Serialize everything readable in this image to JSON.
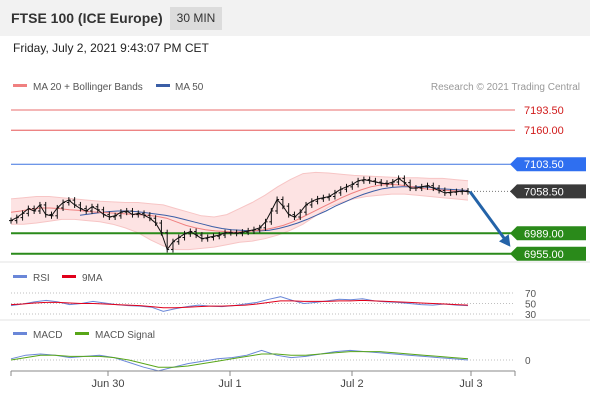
{
  "header": {
    "title": "FTSE 100 (ICE Europe)",
    "timeframe": "30 MIN"
  },
  "datetime": "Friday, July 2, 2021 9:43:07 PM CET",
  "chart_data": [
    {
      "type": "line",
      "panel": "price",
      "legend": [
        {
          "label": "MA 20 + Bollinger Bands",
          "color": "#f08080"
        },
        {
          "label": "MA 50",
          "color": "#3b5ea6"
        }
      ],
      "credit": "Research © 2021 Trading Central",
      "levels": [
        {
          "value": 7193.5,
          "label": "7193.50",
          "kind": "resistance"
        },
        {
          "value": 7160.0,
          "label": "7160.00",
          "kind": "resistance"
        },
        {
          "value": 7103.5,
          "label": "7103.50",
          "kind": "pivot"
        },
        {
          "value": 7058.5,
          "label": "7058.50",
          "kind": "last"
        },
        {
          "value": 6989.0,
          "label": "6989.00",
          "kind": "support"
        },
        {
          "value": 6955.0,
          "label": "6955.00",
          "kind": "support"
        }
      ],
      "x_ticks": [
        "Jun 30",
        "Jul 1",
        "Jul 2",
        "Jul 3"
      ],
      "ylim": [
        6948,
        7215
      ],
      "price": [
        7010,
        7015,
        7022,
        7030,
        7026,
        7036,
        7020,
        7018,
        7031,
        7040,
        7044,
        7036,
        7030,
        7026,
        7033,
        7028,
        7020,
        7016,
        7018,
        7024,
        7026,
        7020,
        7022,
        7019,
        7014,
        7006,
        6990,
        6962,
        6975,
        6982,
        6988,
        6992,
        6986,
        6980,
        6982,
        6984,
        6986,
        6990,
        6990,
        6989,
        6991,
        6993,
        6995,
        6998,
        7008,
        7026,
        7045,
        7034,
        7020,
        7016,
        7024,
        7036,
        7042,
        7046,
        7048,
        7050,
        7056,
        7062,
        7066,
        7070,
        7076,
        7078,
        7076,
        7074,
        7072,
        7071,
        7074,
        7080,
        7073,
        7064,
        7064,
        7066,
        7068,
        7064,
        7060,
        7056,
        7057,
        7058,
        7059,
        7058
      ],
      "ma20": [
        7024,
        7026,
        7029,
        7031,
        7031,
        7030,
        7028,
        7027,
        7025,
        7024,
        7023,
        7022,
        7021,
        7020,
        7019,
        7017,
        7014,
        7008,
        7002,
        6998,
        6995,
        6993,
        6992,
        6991,
        6992,
        6993,
        6995,
        6998,
        7002,
        7008,
        7016,
        7024,
        7032,
        7040,
        7048,
        7055,
        7061,
        7066,
        7069,
        7070,
        7069,
        7067,
        7064,
        7062,
        7061,
        7060,
        7059,
        7059
      ],
      "ma50": [
        7019,
        7021,
        7023,
        7025,
        7026,
        7026,
        7025,
        7023,
        7021,
        7019,
        7016,
        7012,
        7008,
        7004,
        7000,
        6997,
        6995,
        6994,
        6993,
        6993,
        6994,
        6997,
        7001,
        7006,
        7012,
        7019,
        7026,
        7034,
        7041,
        7048,
        7054,
        7059,
        7063,
        7065,
        7066,
        7066,
        7066,
        7065,
        7063,
        7062,
        7061,
        7060
      ],
      "ma50_start_x": 80,
      "bb_upper": [
        7046,
        7048,
        7050,
        7050,
        7048,
        7046,
        7044,
        7042,
        7041,
        7040,
        7040,
        7038,
        7036,
        7030,
        7024,
        7018,
        7016,
        7020,
        7030,
        7040,
        7052,
        7066,
        7078,
        7088,
        7090,
        7089,
        7087,
        7085,
        7084,
        7083,
        7082,
        7081,
        7081,
        7080,
        7080,
        7078,
        7076
      ],
      "bb_lower": [
        7004,
        7004,
        7006,
        7009,
        7012,
        7012,
        7010,
        7008,
        7004,
        6998,
        6990,
        6978,
        6968,
        6962,
        6962,
        6964,
        6966,
        6970,
        6974,
        6976,
        6980,
        6986,
        6994,
        7004,
        7018,
        7032,
        7040,
        7046,
        7050,
        7052,
        7054,
        7054,
        7052,
        7050,
        7048,
        7046,
        7044
      ],
      "forecast": {
        "from": 7058,
        "to": 6972
      }
    },
    {
      "type": "line",
      "panel": "rsi",
      "legend": [
        {
          "label": "RSI",
          "color": "#6a87d8"
        },
        {
          "label": "9MA",
          "color": "#e0001b"
        }
      ],
      "levels": [
        {
          "value": 70,
          "label": "70"
        },
        {
          "value": 50,
          "label": "50"
        },
        {
          "value": 30,
          "label": "30"
        }
      ],
      "rsi": [
        46,
        49,
        53,
        56,
        53,
        48,
        50,
        54,
        51,
        48,
        46,
        45,
        43,
        35,
        40,
        44,
        47,
        45,
        44,
        46,
        49,
        52,
        58,
        63,
        56,
        50,
        52,
        55,
        58,
        57,
        59,
        55,
        53,
        52,
        50,
        48,
        47,
        49,
        47,
        46
      ],
      "ma9": [
        48,
        49,
        51,
        52,
        52,
        51,
        50,
        50,
        49,
        48,
        47,
        46,
        44,
        42,
        42,
        43,
        44,
        45,
        45,
        46,
        47,
        49,
        52,
        55,
        55,
        54,
        54,
        54,
        55,
        55,
        56,
        55,
        54,
        53,
        52,
        51,
        50,
        49,
        48,
        47
      ]
    },
    {
      "type": "line",
      "panel": "macd",
      "legend": [
        {
          "label": "MACD",
          "color": "#6a87d8"
        },
        {
          "label": "MACD Signal",
          "color": "#58a618"
        }
      ],
      "levels": [
        {
          "value": 0,
          "label": "0"
        }
      ],
      "macd": [
        1,
        4,
        5,
        4,
        2,
        3,
        4,
        2,
        -2,
        -6,
        -9,
        -6,
        -3,
        -1,
        1,
        2,
        4,
        8,
        4,
        2,
        3,
        5,
        7,
        8,
        7,
        6,
        5,
        4,
        3,
        2,
        1,
        0
      ],
      "signal": [
        0,
        2,
        4,
        4,
        3,
        3,
        3,
        2,
        0,
        -3,
        -6,
        -6,
        -5,
        -3,
        -1,
        1,
        3,
        5,
        5,
        4,
        4,
        5,
        6,
        7,
        7,
        7,
        6,
        5,
        4,
        3,
        2,
        1
      ]
    }
  ]
}
